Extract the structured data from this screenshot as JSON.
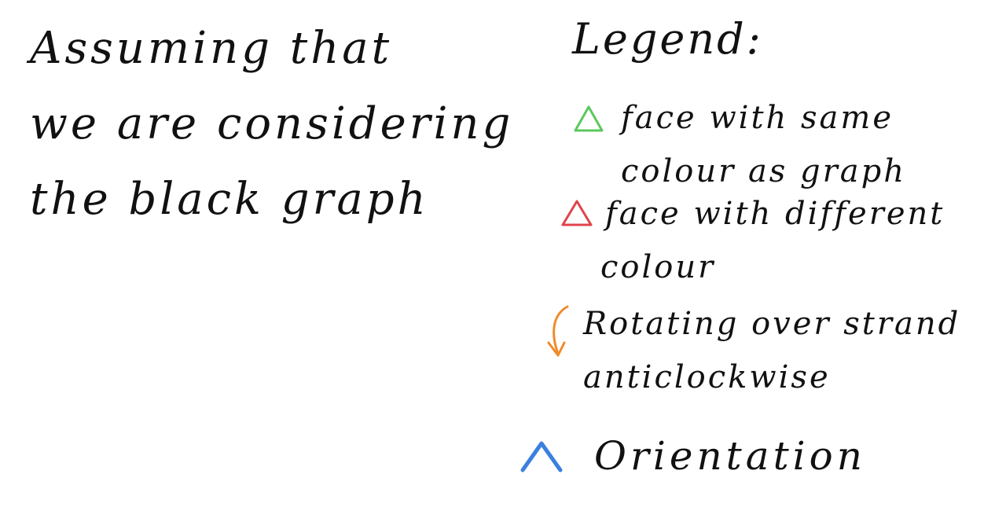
{
  "note": {
    "lines": [
      "Assuming that",
      "we are considering",
      "the black graph"
    ]
  },
  "legend": {
    "title": "Legend:",
    "items": [
      {
        "icon": "green-triangle-icon",
        "color": "#5cc85c",
        "lines": [
          "face with same",
          "colour as graph"
        ]
      },
      {
        "icon": "red-triangle-icon",
        "color": "#e0444c",
        "lines": [
          "face with different",
          "colour"
        ]
      },
      {
        "icon": "orange-curved-arrow-icon",
        "color": "#f08a2c",
        "lines": [
          "Rotating over strand",
          "anticlockwise"
        ]
      },
      {
        "icon": "blue-caret-icon",
        "color": "#3b7fe0",
        "lines": [
          "Orientation"
        ]
      }
    ]
  }
}
